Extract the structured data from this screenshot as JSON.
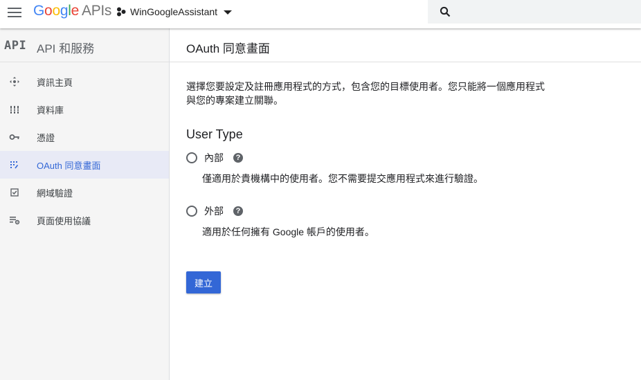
{
  "header": {
    "logo_google": "Google",
    "logo_apis": "APIs",
    "project_name": "WinGoogleAssistant"
  },
  "sidebar": {
    "badge": "API",
    "title": "API 和服務",
    "items": [
      {
        "label": "資訊主頁",
        "icon": "dashboard-icon",
        "active": false
      },
      {
        "label": "資料庫",
        "icon": "library-icon",
        "active": false
      },
      {
        "label": "憑證",
        "icon": "key-icon",
        "active": false
      },
      {
        "label": "OAuth 同意畫面",
        "icon": "consent-screen-icon",
        "active": true
      },
      {
        "label": "網域驗證",
        "icon": "checkbox-icon",
        "active": false
      },
      {
        "label": "頁面使用協議",
        "icon": "page-usage-settings-icon",
        "active": false
      }
    ]
  },
  "main": {
    "title": "OAuth 同意畫面",
    "description": "選擇您要設定及註冊應用程式的方式，包含您的目標使用者。您只能將一個應用程式與您的專案建立關聯。",
    "user_type_heading": "User Type",
    "options": [
      {
        "label": "內部",
        "description": "僅適用於貴機構中的使用者。您不需要提交應用程式來進行驗證。",
        "selected": false
      },
      {
        "label": "外部",
        "description": "適用於任何擁有 Google 帳戶的使用者。",
        "selected": false
      }
    ],
    "create_label": "建立"
  },
  "colors": {
    "accent": "#3367d6",
    "sidebar_bg": "#f5f5f5",
    "active_bg": "#e8eaf6",
    "google_blue": "#4285f4",
    "google_red": "#ea4335",
    "google_yellow": "#fbbc05",
    "google_green": "#34a853"
  }
}
